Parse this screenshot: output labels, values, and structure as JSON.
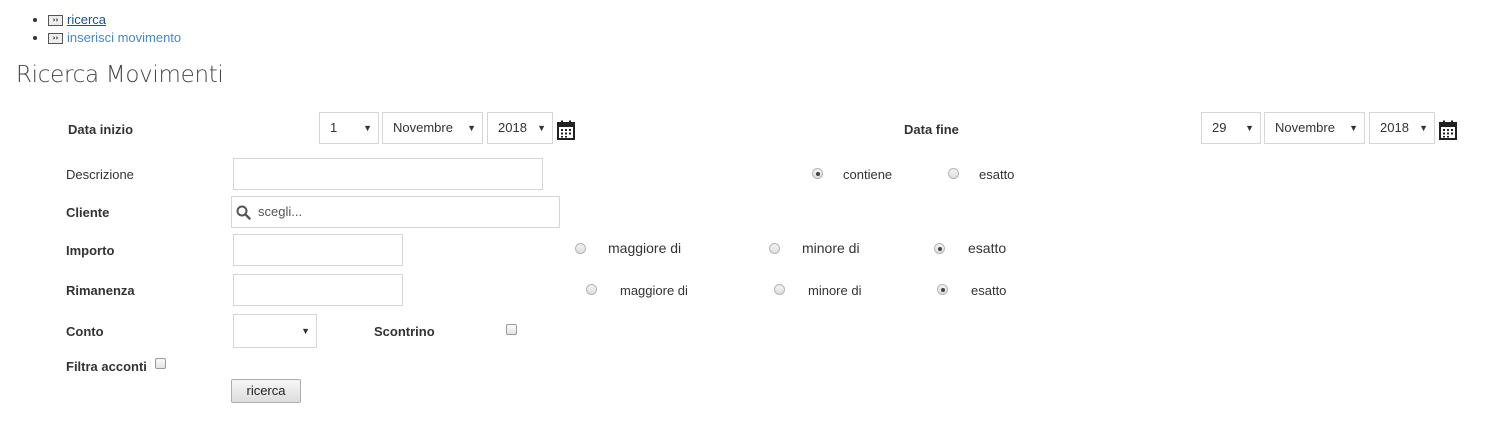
{
  "nav": {
    "items": [
      {
        "label": "ricerca",
        "icon": "double-chevron-right-icon"
      },
      {
        "label": "inserisci movimento",
        "icon": "double-chevron-right-icon"
      }
    ]
  },
  "page": {
    "title": "Ricerca Movimenti"
  },
  "form": {
    "start_date": {
      "label": "Data inizio",
      "day": "1",
      "month": "Novembre",
      "year": "2018"
    },
    "end_date": {
      "label": "Data fine",
      "day": "29",
      "month": "Novembre",
      "year": "2018"
    },
    "description": {
      "label": "Descrizione",
      "value": "",
      "options": [
        "contiene",
        "esatto"
      ],
      "selected": "contiene"
    },
    "client": {
      "label": "Cliente",
      "placeholder": "scegli..."
    },
    "amount": {
      "label": "Importo",
      "value": "",
      "options": [
        "maggiore di",
        "minore di",
        "esatto"
      ],
      "selected": "esatto"
    },
    "remainder": {
      "label": "Rimanenza",
      "value": "",
      "options": [
        "maggiore di",
        "minore di",
        "esatto"
      ],
      "selected": "esatto"
    },
    "account": {
      "label": "Conto",
      "value": ""
    },
    "receipt": {
      "label": "Scontrino",
      "checked": false
    },
    "filter_deposits": {
      "label": "Filtra acconti",
      "checked": false
    },
    "submit_label": "ricerca"
  }
}
